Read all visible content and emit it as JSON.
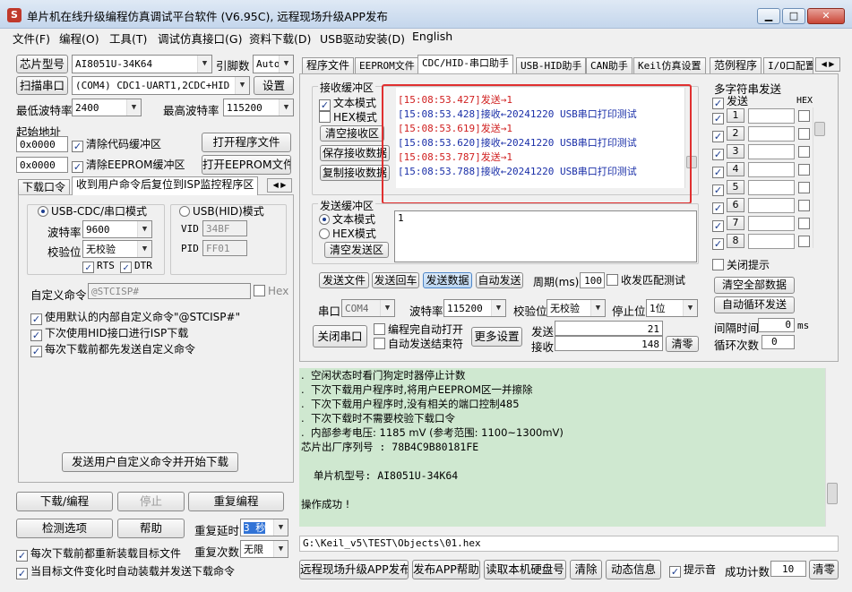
{
  "window": {
    "title": "单片机在线升级编程仿真调试平台软件 (V6.95C), 远程现场升级APP发布",
    "app_icon": "stc-app-icon"
  },
  "menu": [
    "文件(F)",
    "编程(O)",
    "工具(T)",
    "调试仿真接口(G)",
    "资料下载(D)",
    "USB驱动安装(D)",
    "English"
  ],
  "left": {
    "chip_model_btn": "芯片型号",
    "chip_model": "AI8051U-34K64",
    "pin_label": "引脚数",
    "pin_value": "Auto",
    "scan_port_btn": "扫描串口",
    "port": "(COM4) CDC1-UART1,2CDC+HID",
    "settings_btn": "设置",
    "min_baud_label": "最低波特率",
    "min_baud": "2400",
    "max_baud_label": "最高波特率",
    "max_baud": "115200",
    "start_addr_label": "起始地址",
    "addr1": "0x0000",
    "clear_code_cb": "清除代码缓冲区",
    "open_prog_btn": "打开程序文件",
    "addr2": "0x0000",
    "clear_eeprom_cb": "清除EEPROM缓冲区",
    "open_eeprom_btn": "打开EEPROM文件",
    "tabs": [
      "下载口令",
      "收到用户命令后复位到ISP监控程序区"
    ],
    "usb_cdc_radio": "USB-CDC/串口模式",
    "usb_hid_radio": "USB(HID)模式",
    "baud_label": "波特率",
    "baud": "9600",
    "parity_label": "校验位",
    "parity": "无校验",
    "rts": "RTS",
    "dtr": "DTR",
    "vid_label": "VID",
    "vid": "34BF",
    "pid_label": "PID",
    "pid": "FF01",
    "custom_cmd_label": "自定义命令",
    "custom_cmd": "@STCISP#",
    "hex_cb": "Hex",
    "opt1": "使用默认的内部自定义命令\"@STCISP#\"",
    "opt2": "下次使用HID接口进行ISP下载",
    "opt3": "每次下载前都先发送自定义命令",
    "send_custom_btn": "发送用户自定义命令并开始下载",
    "download_btn": "下载/编程",
    "stop_btn": "停止",
    "reprogram_btn": "重复编程",
    "detect_btn": "检测选项",
    "help_btn": "帮助",
    "repeat_delay_label": "重复延时",
    "repeat_delay": "3 秒",
    "repeat_count_label": "重复次数",
    "repeat_count": "无限",
    "reload_cb": "每次下载前都重新装载目标文件",
    "auto_load_cb": "当目标文件变化时自动装载并发送下载命令"
  },
  "right": {
    "tabs": [
      "程序文件",
      "EEPROM文件",
      "CDC/HID-串口助手",
      "USB-HID助手",
      "CAN助手",
      "Keil仿真设置",
      "范例程序",
      "I/O口配置"
    ],
    "recv_group": "接收缓冲区",
    "recv_text_mode": "文本模式",
    "recv_hex_mode": "HEX模式",
    "clear_recv_btn": "清空接收区",
    "save_recv_btn": "保存接收数据",
    "copy_recv_btn": "复制接收数据",
    "recv_lines": [
      {
        "t": "[15:08:53.427]发送→1",
        "k": "sent"
      },
      {
        "t": "[15:08:53.428]接收←20241220 USB串口打印测试",
        "k": "rcv"
      },
      {
        "t": "[15:08:53.619]发送→1",
        "k": "sent"
      },
      {
        "t": "[15:08:53.620]接收←20241220 USB串口打印测试",
        "k": "rcv"
      },
      {
        "t": "[15:08:53.787]发送→1",
        "k": "sent"
      },
      {
        "t": "[15:08:53.788]接收←20241220 USB串口打印测试",
        "k": "rcv"
      }
    ],
    "send_group": "发送缓冲区",
    "send_text_mode": "文本模式",
    "send_hex_mode": "HEX模式",
    "clear_send_btn": "清空发送区",
    "send_content": "1",
    "send_file_btn": "发送文件",
    "send_enter_btn": "发送回车",
    "send_data_btn": "发送数据",
    "auto_send_btn": "自动发送",
    "period_label": "周期(ms)",
    "period": "100",
    "match_cb": "收发匹配测试",
    "port_label": "串口",
    "port": "COM4",
    "baud_label": "波特率",
    "baud": "115200",
    "parity_label": "校验位",
    "parity": "无校验",
    "stop_label": "停止位",
    "stop": "1位",
    "close_port_btn": "关闭串口",
    "auto_open_cb": "编程完自动打开",
    "auto_send_end_cb": "自动发送结束符",
    "more_settings_btn": "更多设置",
    "send_count_label": "发送",
    "send_count": "21",
    "recv_count_label": "接收",
    "recv_count": "148",
    "clear_count_btn": "清零",
    "multi_title": "多字符串发送",
    "multi_send_header": "发送",
    "multi_hex_header": "HEX",
    "multi_items": [
      "1",
      "2",
      "3",
      "4",
      "5",
      "6",
      "7",
      "8"
    ],
    "close_tip_cb": "关闭提示",
    "clear_all_btn": "清空全部数据",
    "auto_loop_btn": "自动循环发送",
    "interval_label": "间隔时间",
    "interval": "0",
    "interval_unit": "ms",
    "loop_count_label": "循环次数",
    "loop_count": "0"
  },
  "log": [
    ".  空闲状态时看门狗定时器停止计数",
    ".  下次下载用户程序时,将用户EEPROM区一并擦除",
    ".  下次下载用户程序时,没有相关的端口控制485",
    ".  下次下载时不需要校验下载口令",
    ".  内部参考电压: 1185 mV (参考范围: 1100~1300mV)",
    "芯片出厂序列号 : 78B4C9B80181FE",
    "",
    "  单片机型号: AI8051U-34K64",
    "",
    "操作成功 !"
  ],
  "path": "G:\\Keil_v5\\TEST\\Objects\\01.hex",
  "bottom": {
    "publish_btn": "远程现场升级APP发布",
    "publish_help_btn": "发布APP帮助",
    "read_disk_btn": "读取本机硬盘号",
    "clear_btn": "清除",
    "anim_btn": "动态信息",
    "sound_cb": "提示音",
    "success_label": "成功计数",
    "success_count": "10",
    "reset_btn": "清零"
  }
}
